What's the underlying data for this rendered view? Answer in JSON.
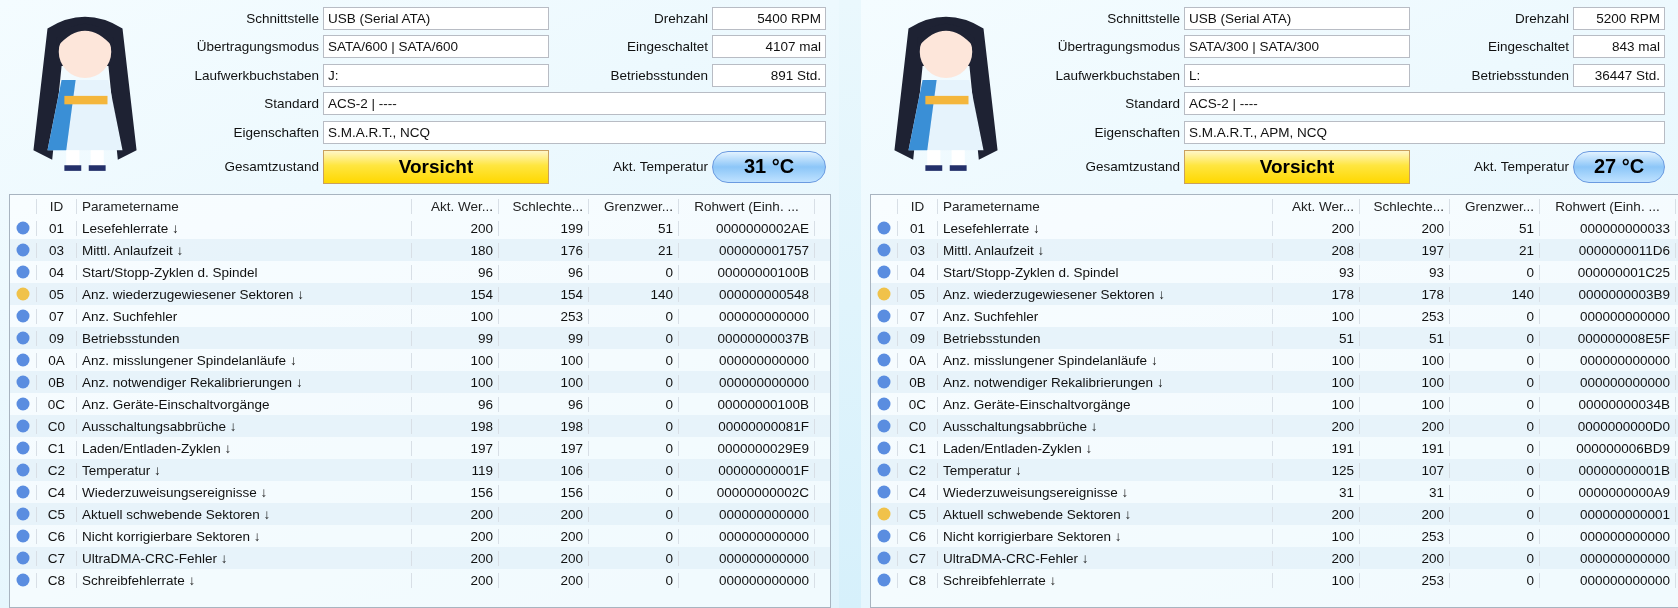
{
  "drives": [
    {
      "interface": {
        "label": "Schnittstelle",
        "value": "USB (Serial ATA)"
      },
      "transfer_mode": {
        "label": "Übertragungsmodus",
        "value": "SATA/600 | SATA/600"
      },
      "drive_letter": {
        "label": "Laufwerkbuchstaben",
        "value": "J:"
      },
      "standard": {
        "label": "Standard",
        "value": "ACS-2 | ----"
      },
      "features": {
        "label": "Eigenschaften",
        "value": "S.M.A.R.T., NCQ"
      },
      "rotation": {
        "label": "Drehzahl",
        "value": "5400 RPM"
      },
      "power_on_count": {
        "label": "Eingeschaltet",
        "value": "4107 mal"
      },
      "power_on_hours": {
        "label": "Betriebsstunden",
        "value": "891 Std."
      },
      "health": {
        "label": "Gesamtzustand",
        "value": "Vorsicht",
        "kind": "caution"
      },
      "temperature": {
        "label": "Akt. Temperatur",
        "value": "31 °C"
      },
      "table": {
        "columns": [
          "ID",
          "Parametername",
          "Akt. Wer...",
          "Schlechte...",
          "Grenzwer...",
          "Rohwert (Einh. ..."
        ],
        "rows": [
          {
            "color": "#5a8de0",
            "id": "01",
            "name": "Lesefehlerrate ↓",
            "current": "200",
            "worst": "199",
            "threshold": "51",
            "raw": "0000000002AE"
          },
          {
            "color": "#5a8de0",
            "id": "03",
            "name": "Mittl. Anlaufzeit ↓",
            "current": "180",
            "worst": "176",
            "threshold": "21",
            "raw": "000000001757"
          },
          {
            "color": "#5a8de0",
            "id": "04",
            "name": "Start/Stopp-Zyklen d. Spindel",
            "current": "96",
            "worst": "96",
            "threshold": "0",
            "raw": "00000000100B"
          },
          {
            "color": "#f0c24a",
            "id": "05",
            "name": "Anz. wiederzugewiesener Sektoren ↓",
            "current": "154",
            "worst": "154",
            "threshold": "140",
            "raw": "000000000548"
          },
          {
            "color": "#5a8de0",
            "id": "07",
            "name": "Anz. Suchfehler",
            "current": "100",
            "worst": "253",
            "threshold": "0",
            "raw": "000000000000"
          },
          {
            "color": "#5a8de0",
            "id": "09",
            "name": "Betriebsstunden",
            "current": "99",
            "worst": "99",
            "threshold": "0",
            "raw": "00000000037B"
          },
          {
            "color": "#5a8de0",
            "id": "0A",
            "name": "Anz. misslungener Spindelanläufe ↓",
            "current": "100",
            "worst": "100",
            "threshold": "0",
            "raw": "000000000000"
          },
          {
            "color": "#5a8de0",
            "id": "0B",
            "name": "Anz. notwendiger Rekalibrierungen ↓",
            "current": "100",
            "worst": "100",
            "threshold": "0",
            "raw": "000000000000"
          },
          {
            "color": "#5a8de0",
            "id": "0C",
            "name": "Anz. Geräte-Einschaltvorgänge",
            "current": "96",
            "worst": "96",
            "threshold": "0",
            "raw": "00000000100B"
          },
          {
            "color": "#5a8de0",
            "id": "C0",
            "name": "Ausschaltungsabbrüche ↓",
            "current": "198",
            "worst": "198",
            "threshold": "0",
            "raw": "00000000081F"
          },
          {
            "color": "#5a8de0",
            "id": "C1",
            "name": "Laden/Entladen-Zyklen ↓",
            "current": "197",
            "worst": "197",
            "threshold": "0",
            "raw": "0000000029E9"
          },
          {
            "color": "#5a8de0",
            "id": "C2",
            "name": "Temperatur ↓",
            "current": "119",
            "worst": "106",
            "threshold": "0",
            "raw": "00000000001F"
          },
          {
            "color": "#5a8de0",
            "id": "C4",
            "name": "Wiederzuweisungsereignisse ↓",
            "current": "156",
            "worst": "156",
            "threshold": "0",
            "raw": "00000000002C"
          },
          {
            "color": "#5a8de0",
            "id": "C5",
            "name": "Aktuell schwebende Sektoren ↓",
            "current": "200",
            "worst": "200",
            "threshold": "0",
            "raw": "000000000000"
          },
          {
            "color": "#5a8de0",
            "id": "C6",
            "name": "Nicht korrigierbare Sektoren ↓",
            "current": "200",
            "worst": "200",
            "threshold": "0",
            "raw": "000000000000"
          },
          {
            "color": "#5a8de0",
            "id": "C7",
            "name": "UltraDMA-CRC-Fehler ↓",
            "current": "200",
            "worst": "200",
            "threshold": "0",
            "raw": "000000000000"
          },
          {
            "color": "#5a8de0",
            "id": "C8",
            "name": "Schreibfehlerrate ↓",
            "current": "200",
            "worst": "200",
            "threshold": "0",
            "raw": "000000000000"
          }
        ]
      }
    },
    {
      "interface": {
        "label": "Schnittstelle",
        "value": "USB (Serial ATA)"
      },
      "transfer_mode": {
        "label": "Übertragungsmodus",
        "value": "SATA/300 | SATA/300"
      },
      "drive_letter": {
        "label": "Laufwerkbuchstaben",
        "value": "L:"
      },
      "standard": {
        "label": "Standard",
        "value": "ACS-2 | ----"
      },
      "features": {
        "label": "Eigenschaften",
        "value": "S.M.A.R.T., APM, NCQ"
      },
      "rotation": {
        "label": "Drehzahl",
        "value": "5200 RPM"
      },
      "power_on_count": {
        "label": "Eingeschaltet",
        "value": "843 mal"
      },
      "power_on_hours": {
        "label": "Betriebsstunden",
        "value": "36447 Std."
      },
      "health": {
        "label": "Gesamtzustand",
        "value": "Vorsicht",
        "kind": "caution"
      },
      "temperature": {
        "label": "Akt. Temperatur",
        "value": "27 °C"
      },
      "table": {
        "columns": [
          "ID",
          "Parametername",
          "Akt. Wer...",
          "Schlechte...",
          "Grenzwer...",
          "Rohwert (Einh. ..."
        ],
        "rows": [
          {
            "color": "#5a8de0",
            "id": "01",
            "name": "Lesefehlerrate ↓",
            "current": "200",
            "worst": "200",
            "threshold": "51",
            "raw": "000000000033"
          },
          {
            "color": "#5a8de0",
            "id": "03",
            "name": "Mittl. Anlaufzeit ↓",
            "current": "208",
            "worst": "197",
            "threshold": "21",
            "raw": "0000000011D6"
          },
          {
            "color": "#5a8de0",
            "id": "04",
            "name": "Start/Stopp-Zyklen d. Spindel",
            "current": "93",
            "worst": "93",
            "threshold": "0",
            "raw": "000000001C25"
          },
          {
            "color": "#f0c24a",
            "id": "05",
            "name": "Anz. wiederzugewiesener Sektoren ↓",
            "current": "178",
            "worst": "178",
            "threshold": "140",
            "raw": "0000000003B9"
          },
          {
            "color": "#5a8de0",
            "id": "07",
            "name": "Anz. Suchfehler",
            "current": "100",
            "worst": "253",
            "threshold": "0",
            "raw": "000000000000"
          },
          {
            "color": "#5a8de0",
            "id": "09",
            "name": "Betriebsstunden",
            "current": "51",
            "worst": "51",
            "threshold": "0",
            "raw": "000000008E5F"
          },
          {
            "color": "#5a8de0",
            "id": "0A",
            "name": "Anz. misslungener Spindelanläufe ↓",
            "current": "100",
            "worst": "100",
            "threshold": "0",
            "raw": "000000000000"
          },
          {
            "color": "#5a8de0",
            "id": "0B",
            "name": "Anz. notwendiger Rekalibrierungen ↓",
            "current": "100",
            "worst": "100",
            "threshold": "0",
            "raw": "000000000000"
          },
          {
            "color": "#5a8de0",
            "id": "0C",
            "name": "Anz. Geräte-Einschaltvorgänge",
            "current": "100",
            "worst": "100",
            "threshold": "0",
            "raw": "00000000034B"
          },
          {
            "color": "#5a8de0",
            "id": "C0",
            "name": "Ausschaltungsabbrüche ↓",
            "current": "200",
            "worst": "200",
            "threshold": "0",
            "raw": "0000000000D0"
          },
          {
            "color": "#5a8de0",
            "id": "C1",
            "name": "Laden/Entladen-Zyklen ↓",
            "current": "191",
            "worst": "191",
            "threshold": "0",
            "raw": "000000006BD9"
          },
          {
            "color": "#5a8de0",
            "id": "C2",
            "name": "Temperatur ↓",
            "current": "125",
            "worst": "107",
            "threshold": "0",
            "raw": "00000000001B"
          },
          {
            "color": "#5a8de0",
            "id": "C4",
            "name": "Wiederzuweisungsereignisse ↓",
            "current": "31",
            "worst": "31",
            "threshold": "0",
            "raw": "0000000000A9"
          },
          {
            "color": "#f0c24a",
            "id": "C5",
            "name": "Aktuell schwebende Sektoren ↓",
            "current": "200",
            "worst": "200",
            "threshold": "0",
            "raw": "000000000001"
          },
          {
            "color": "#5a8de0",
            "id": "C6",
            "name": "Nicht korrigierbare Sektoren ↓",
            "current": "100",
            "worst": "253",
            "threshold": "0",
            "raw": "000000000000"
          },
          {
            "color": "#5a8de0",
            "id": "C7",
            "name": "UltraDMA-CRC-Fehler ↓",
            "current": "200",
            "worst": "200",
            "threshold": "0",
            "raw": "000000000000"
          },
          {
            "color": "#5a8de0",
            "id": "C8",
            "name": "Schreibfehlerrate ↓",
            "current": "100",
            "worst": "253",
            "threshold": "0",
            "raw": "000000000000"
          }
        ]
      }
    }
  ]
}
